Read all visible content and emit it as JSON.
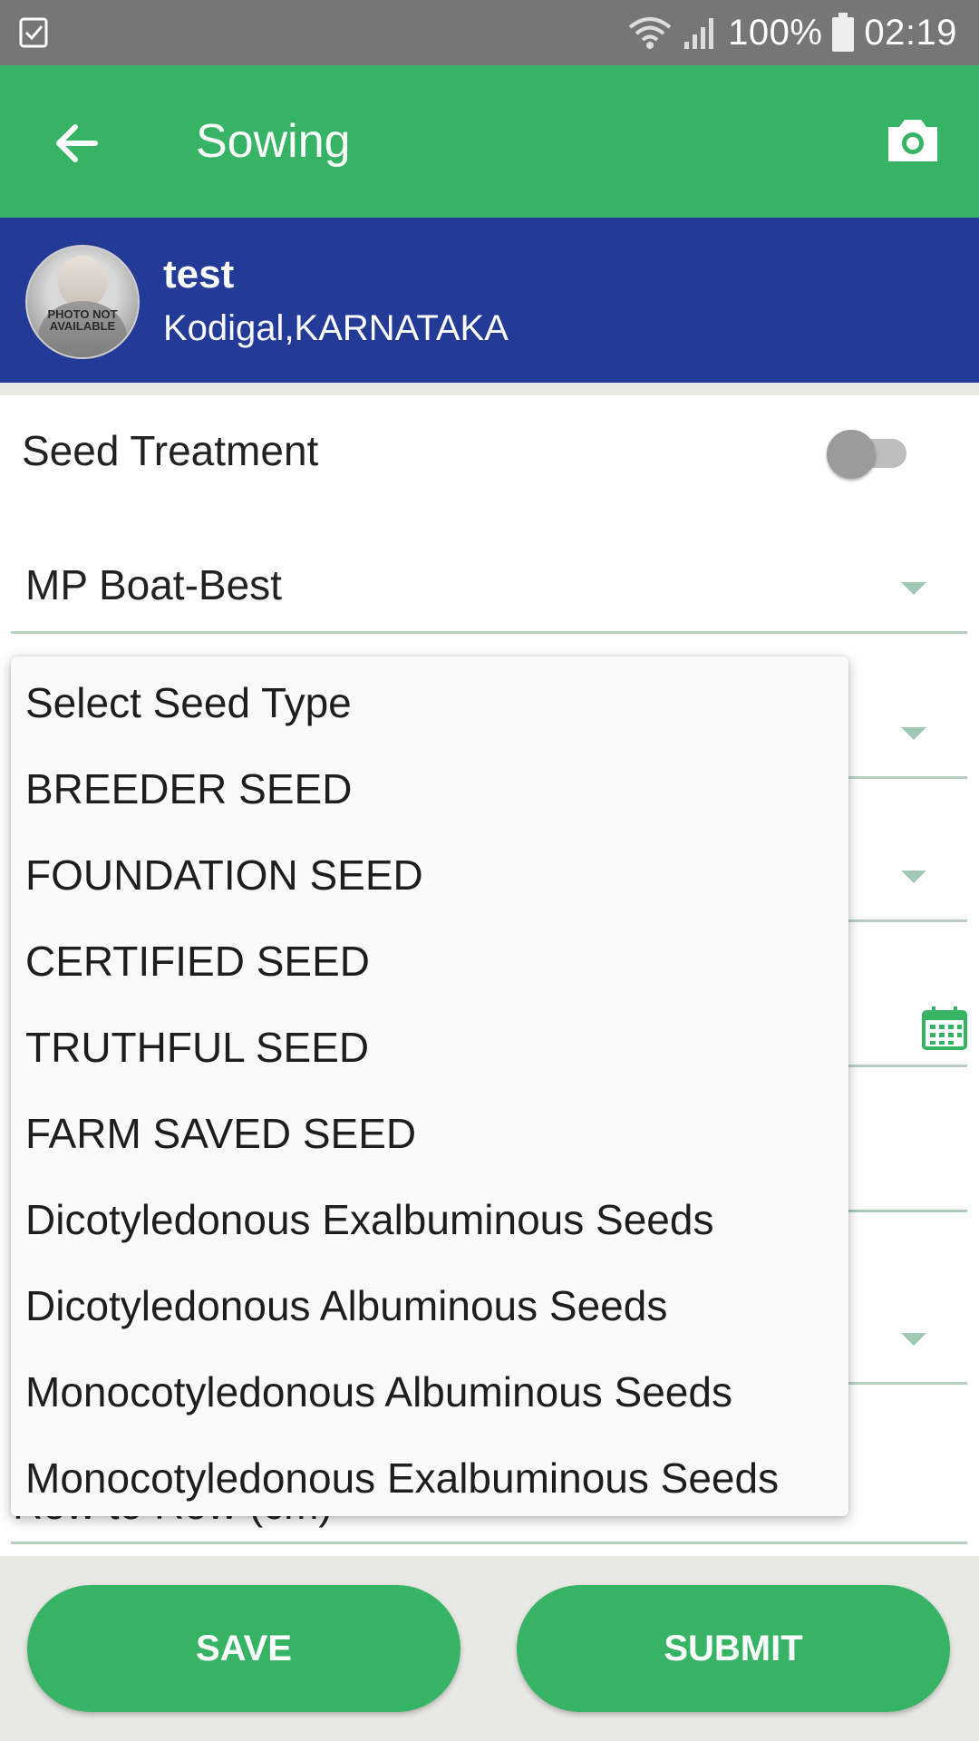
{
  "status_bar": {
    "battery_percent": "100%",
    "time": "02:19",
    "icons": [
      "checkbox-icon",
      "wifi-icon",
      "signal-icon",
      "battery-icon"
    ]
  },
  "app_bar": {
    "title": "Sowing",
    "back_icon": "arrow-left-icon",
    "camera_icon": "camera-icon",
    "background_color": "#37b366"
  },
  "profile": {
    "name": "test",
    "location": "Kodigal,KARNATAKA",
    "avatar_text": "PHOTO NOT AVAILABLE",
    "background_color": "#233a96"
  },
  "form": {
    "seed_treatment_label": "Seed Treatment",
    "seed_treatment_enabled": false,
    "variety_value": "MP Boat-Best",
    "partially_hidden_label": "Row to Row (cm)"
  },
  "seed_type_dropdown": {
    "options": [
      "Select Seed Type",
      "BREEDER SEED",
      "FOUNDATION SEED",
      "CERTIFIED SEED",
      "TRUTHFUL SEED",
      "FARM SAVED SEED",
      "Dicotyledonous Exalbuminous Seeds",
      "Dicotyledonous Albuminous Seeds",
      "Monocotyledonous Albuminous Seeds",
      "Monocotyledonous Exalbuminous Seeds"
    ]
  },
  "buttons": {
    "save_label": "SAVE",
    "submit_label": "SUBMIT"
  }
}
